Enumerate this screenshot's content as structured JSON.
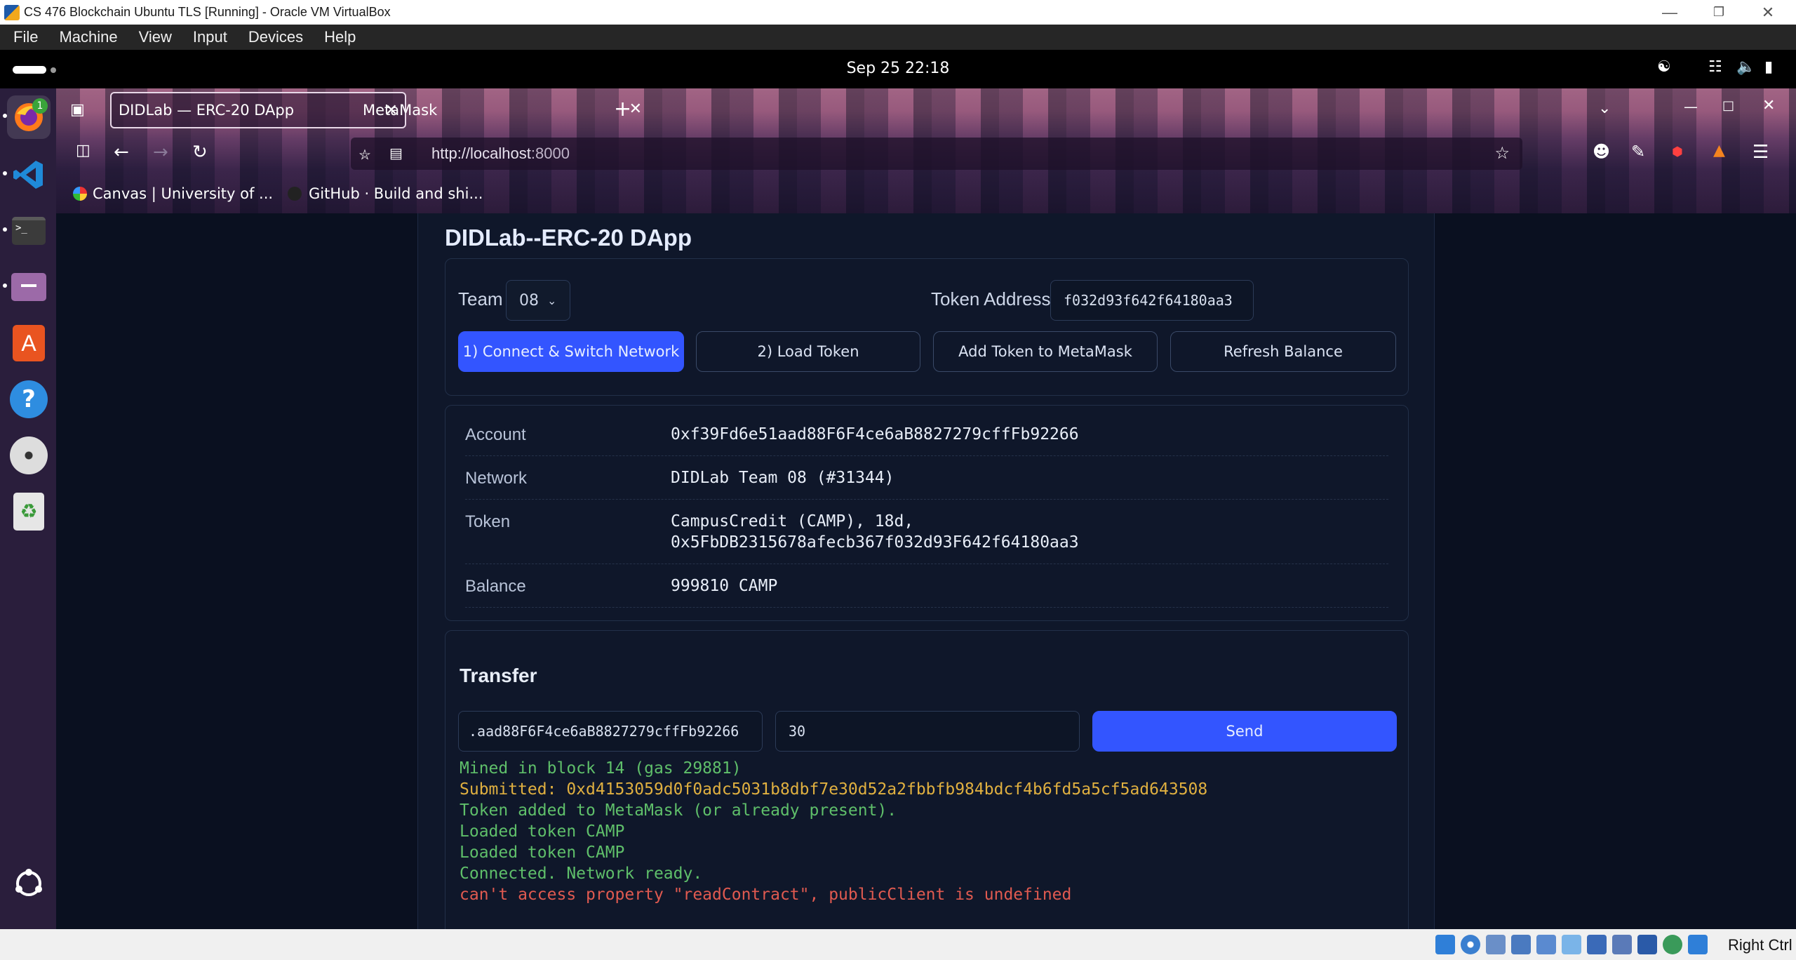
{
  "host_window": {
    "title": "CS 476 Blockchain Ubuntu TLS [Running] - Oracle VM VirtualBox",
    "menu": [
      "File",
      "Machine",
      "View",
      "Input",
      "Devices",
      "Help"
    ]
  },
  "ubuntu": {
    "clock": "Sep 25  22:18",
    "dock_badge": "1",
    "dock_items": [
      "firefox-icon",
      "vscode-icon",
      "terminal-icon",
      "files-icon",
      "app-center-icon",
      "help-icon",
      "disc-icon",
      "trash-icon",
      "show-apps-icon"
    ]
  },
  "browser": {
    "tabs": [
      {
        "label": "DIDLab — ERC-20 DApp",
        "active": true
      },
      {
        "label": "MetaMask",
        "active": false
      }
    ],
    "new_tab": "+",
    "url_host": "http://localhost",
    "url_port": ":8000",
    "bookmarks": [
      "Canvas | University of ...",
      "GitHub · Build and shi..."
    ]
  },
  "app": {
    "title": "DIDLab--ERC-20 DApp",
    "team_label": "Team",
    "team_value": "08",
    "token_address_label": "Token Address",
    "token_address_value": "f032d93f642f64180aa3",
    "buttons": {
      "connect": "1) Connect & Switch Network",
      "load": "2) Load Token",
      "add_token": "Add Token to MetaMask",
      "refresh": "Refresh Balance"
    },
    "info": {
      "account_label": "Account",
      "account_value": "0xf39Fd6e51aad88F6F4ce6aB8827279cffFb92266",
      "network_label": "Network",
      "network_value": "DIDLab Team 08 (#31344)",
      "token_label": "Token",
      "token_value_line1": "CampusCredit (CAMP), 18d,",
      "token_value_line2": "0x5FbDB2315678afecb367f032d93F642f64180aa3",
      "balance_label": "Balance",
      "balance_value": "999810 CAMP"
    },
    "transfer": {
      "heading": "Transfer",
      "recipient_value": ".aad88F6F4ce6aB8827279cffFb92266",
      "amount_value": "30",
      "send_label": "Send"
    },
    "log": [
      {
        "text": "Mined in block 14 (gas 29881)",
        "color": "#5fbf6a"
      },
      {
        "text": "Submitted: 0xd4153059d0f0adc5031b8dbf7e30d52a2fbbfb984bdcf4b6fd5a5cf5ad643508",
        "color": "#e0b040"
      },
      {
        "text": "Token added to MetaMask (or already present).",
        "color": "#5fbf6a"
      },
      {
        "text": "Loaded token CAMP",
        "color": "#5fbf6a"
      },
      {
        "text": "Loaded token CAMP",
        "color": "#5fbf6a"
      },
      {
        "text": "Connected. Network ready.",
        "color": "#5fbf6a"
      },
      {
        "text": "can't access property \"readContract\", publicClient is undefined",
        "color": "#e05a50"
      }
    ]
  },
  "status_bar": {
    "host_key": "Right Ctrl"
  }
}
